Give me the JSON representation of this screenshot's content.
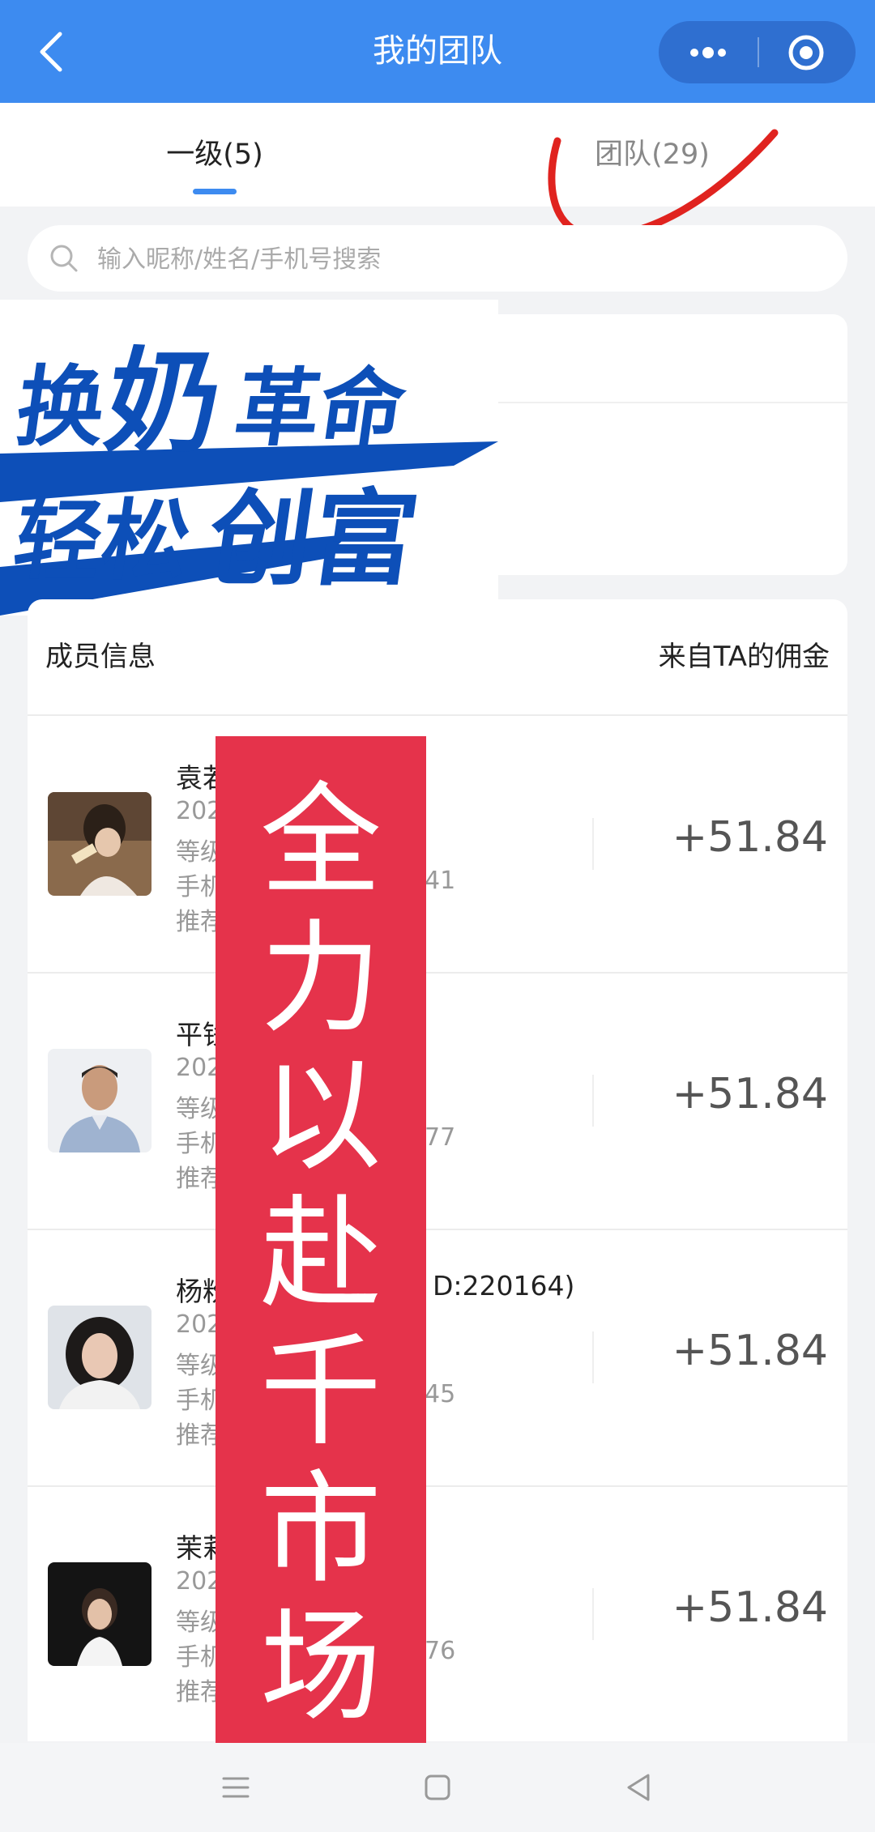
{
  "header": {
    "title": "我的团队"
  },
  "tabs": [
    {
      "label": "一级(5)",
      "active": true
    },
    {
      "label": "团队(29)",
      "active": false
    }
  ],
  "search": {
    "placeholder": "输入昵称/姓名/手机号搜索"
  },
  "banner": {
    "line1_a": "换",
    "line1_b": "奶",
    "line1_c": "革命",
    "line2_a": "轻松",
    "line2_b": "创富"
  },
  "list": {
    "header_left": "成员信息",
    "header_right": "来自TA的佣金",
    "members": [
      {
        "name": "袁若",
        "line1": "202",
        "line2": "等级",
        "line3": "手机",
        "line3_tail": "41",
        "line4": "推荐",
        "amount": "+51.84"
      },
      {
        "name": "平钱",
        "line1": "202",
        "line2": "等级",
        "line3": "手机",
        "line3_tail": "77",
        "line4": "推荐",
        "amount": "+51.84"
      },
      {
        "name": "杨粉",
        "name_tail": "D:220164)",
        "line1": "202",
        "line2": "等级",
        "line3": "手机",
        "line3_tail": "45",
        "line4": "推荐",
        "amount": "+51.84"
      },
      {
        "name": "茉莉",
        "line1": "202",
        "line2": "等级",
        "line3": "手机",
        "line3_tail": "76",
        "line4": "推荐",
        "amount": "+51.84"
      }
    ]
  },
  "overlay": {
    "chars": [
      "全",
      "力",
      "以",
      "赴",
      "千",
      "市",
      "场"
    ]
  },
  "colors": {
    "primary": "#3d8bf0",
    "overlay_red": "#e5334b",
    "banner_blue": "#0d4fb8"
  }
}
